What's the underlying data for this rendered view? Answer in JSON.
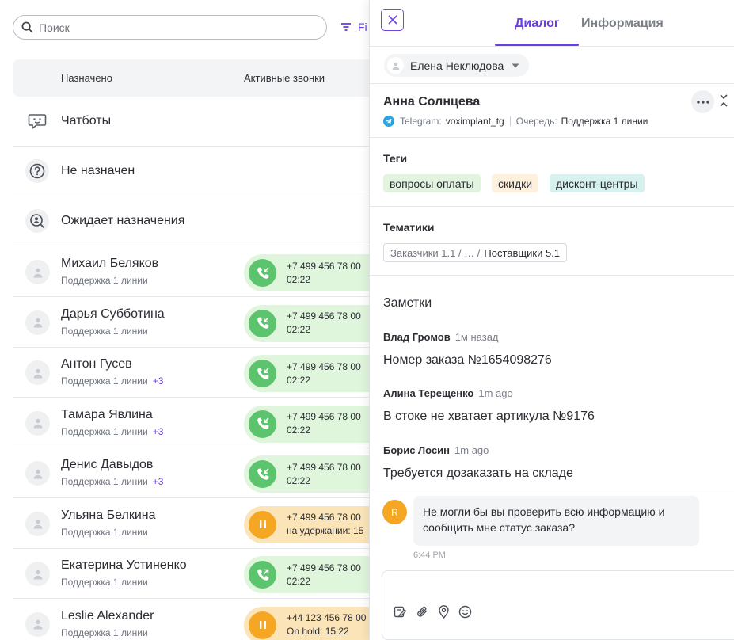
{
  "left": {
    "search": {
      "placeholder": "Поиск"
    },
    "filter_label": "Fi",
    "table_head": {
      "assigned": "Назначено",
      "active_calls": "Активные звонки"
    },
    "system_rows": [
      {
        "label": "Чатботы",
        "icon": "chatbot-icon"
      },
      {
        "label": "Не назначен",
        "icon": "question-icon"
      },
      {
        "label": "Ожидает назначения",
        "icon": "search-user-icon"
      }
    ],
    "users": [
      {
        "name": "Михаил Беляков",
        "team": "Поддержка 1 линии",
        "extra": "",
        "phone": "+7 499 456 78 00",
        "status": "02:22",
        "call_state": "incoming",
        "color": "green"
      },
      {
        "name": "Дарья Субботина",
        "team": "Поддержка 1 линии",
        "extra": "",
        "phone": "+7 499 456 78 00",
        "status": "02:22",
        "call_state": "incoming",
        "color": "green"
      },
      {
        "name": "Антон Гусев",
        "team": "Поддержка 1 линии",
        "extra": "+3",
        "phone": "+7 499 456 78 00",
        "status": "02:22",
        "call_state": "incoming",
        "color": "green"
      },
      {
        "name": "Тамара Явлина",
        "team": "Поддержка 1 линии",
        "extra": "+3",
        "phone": "+7 499 456 78 00",
        "status": "02:22",
        "call_state": "incoming",
        "color": "green"
      },
      {
        "name": "Денис Давыдов",
        "team": "Поддержка 1 линии",
        "extra": "+3",
        "phone": "+7 499 456 78 00",
        "status": "02:22",
        "call_state": "incoming",
        "color": "green"
      },
      {
        "name": "Ульяна Белкина",
        "team": "Поддержка 1 линии",
        "extra": "",
        "phone": "+7 499 456 78 00",
        "status": "на удержании: 15",
        "call_state": "hold",
        "color": "orange"
      },
      {
        "name": "Екатерина Устиненко",
        "team": "Поддержка 1 линии",
        "extra": "",
        "phone": "+7 499 456 78 00",
        "status": "02:22",
        "call_state": "outgoing",
        "color": "green"
      },
      {
        "name": "Leslie Alexander",
        "team": "Поддержка 1 линии",
        "extra": "",
        "phone": "+44 123 456 78 00",
        "status": "On hold: 15:22",
        "call_state": "hold",
        "color": "orange"
      }
    ]
  },
  "right": {
    "tabs": {
      "dialog": "Диалог",
      "info": "Информация"
    },
    "agent": "Елена Неклюдова",
    "contact": {
      "name": "Анна Солнцева",
      "channel_label": "Telegram:",
      "channel_value": "voximplant_tg",
      "queue_label": "Очередь:",
      "queue_value": "Поддержка 1 линии"
    },
    "tags_title": "Теги",
    "tags": [
      {
        "label": "вопросы оплаты",
        "color": "#e2f4e0"
      },
      {
        "label": "скидки",
        "color": "#fdf0dc"
      },
      {
        "label": "дисконт-центры",
        "color": "#d6f1ee"
      }
    ],
    "themes_title": "Тематики",
    "theme_path": {
      "prefix": "Заказчики 1.1 / … /",
      "last": "Поставщики 5.1"
    },
    "notes_title": "Заметки",
    "notes": [
      {
        "author": "Влад Громов",
        "time": "1м назад",
        "text": "Номер заказа №1654098276"
      },
      {
        "author": "Алина Терещенко",
        "time": "1m ago",
        "text": "В стоке не хватает артикула №9176"
      },
      {
        "author": "Борис Лосин",
        "time": "1m ago",
        "text": "Требуется дозаказать на складе"
      }
    ],
    "message": {
      "avatar_letter": "R",
      "text_line1": "Не могли бы вы проверить всю информацию и",
      "text_line2": "сообщить мне статус заказа?",
      "time": "6:44 PM"
    }
  },
  "colors": {
    "accent": "#6a3fe0",
    "call_green": "#5cc46d",
    "call_orange": "#f5a623"
  }
}
